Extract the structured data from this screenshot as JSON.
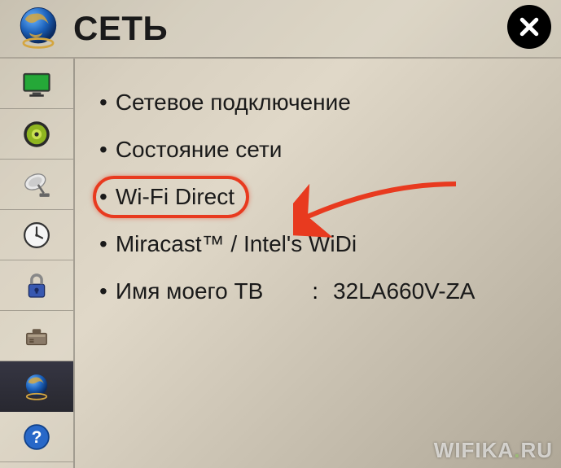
{
  "header": {
    "title": "СЕТЬ"
  },
  "sidebar": {
    "items": [
      {
        "icon": "display-icon"
      },
      {
        "icon": "audio-icon"
      },
      {
        "icon": "satellite-icon"
      },
      {
        "icon": "clock-icon"
      },
      {
        "icon": "lock-icon"
      },
      {
        "icon": "settings-icon"
      },
      {
        "icon": "network-icon"
      },
      {
        "icon": "help-icon"
      }
    ]
  },
  "menu": {
    "items": [
      {
        "label": "Сетевое подключение"
      },
      {
        "label": "Состояние сети"
      },
      {
        "label": "Wi-Fi Direct",
        "highlighted": true
      },
      {
        "label": "Miracast™ / Intel's WiDi"
      },
      {
        "label": "Имя моего ТВ",
        "value": "32LA660V-ZA"
      }
    ]
  },
  "watermark": {
    "text_a": "WIFIKA",
    "text_b": "RU"
  }
}
